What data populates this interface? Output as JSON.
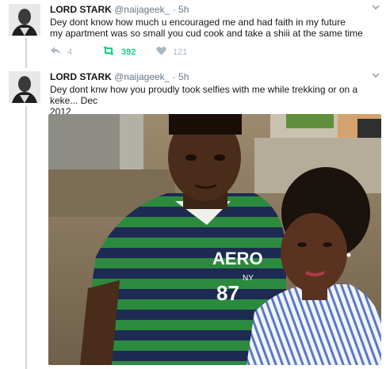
{
  "tweets": [
    {
      "name": "LORD STARK",
      "handle": "@naijageek_",
      "dot": "·",
      "time": "5h",
      "line1": "Dey dont know how much u encouraged me and had faith in my future",
      "line2": "my apartment was so small you cud cook and take a shiii at the same time",
      "reply_count": "4",
      "retweet_count": "392",
      "like_count": "121",
      "colors": {
        "retweet": "#19cf86",
        "icon": "#aab8c2"
      }
    },
    {
      "name": "LORD STARK",
      "handle": "@naijageek_",
      "dot": "·",
      "time": "5h",
      "line1": "Dey dont knw how you proudly took selfies with me while trekking or on a keke... Dec",
      "line2": "2012",
      "photo_shirt_text": "AERO",
      "photo_shirt_sub": "NY",
      "photo_shirt_num": "87"
    }
  ]
}
